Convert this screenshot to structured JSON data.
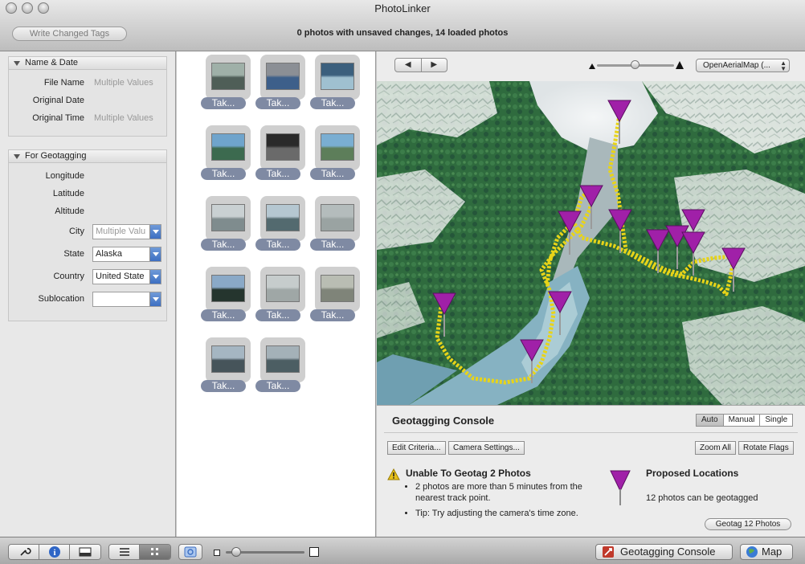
{
  "window": {
    "title": "PhotoLinker"
  },
  "toolbar": {
    "write_changed_tags": "Write Changed Tags",
    "status": "0 photos with unsaved changes, 14 loaded photos"
  },
  "inspector": {
    "name_date": {
      "title": "Name & Date",
      "fields": [
        {
          "label": "File Name",
          "value": "Multiple Values"
        },
        {
          "label": "Original Date",
          "value": ""
        },
        {
          "label": "Original Time",
          "value": "Multiple Values"
        }
      ]
    },
    "geotag": {
      "title": "For Geotagging",
      "longitude": "Longitude",
      "latitude": "Latitude",
      "altitude": "Altitude",
      "city_label": "City",
      "city_value": "Multiple Valu",
      "state_label": "State",
      "state_value": "Alaska",
      "country_label": "Country",
      "country_value": "United State",
      "sublocation_label": "Sublocation",
      "sublocation_value": ""
    }
  },
  "photos": {
    "caption": "Tak...",
    "items": [
      {
        "id": 1,
        "c1": "#9fb0a8",
        "c2": "#4f5e57"
      },
      {
        "id": 2,
        "c1": "#8b8f95",
        "c2": "#3d5f8a"
      },
      {
        "id": 3,
        "c1": "#3b5f7d",
        "c2": "#9fc0d0"
      },
      {
        "id": 4,
        "c1": "#6fa4cc",
        "c2": "#3c6a4f"
      },
      {
        "id": 5,
        "c1": "#2a2a2a",
        "c2": "#6a6a6a"
      },
      {
        "id": 6,
        "c1": "#7aaed2",
        "c2": "#5d7e5a"
      },
      {
        "id": 7,
        "c1": "#c9d0d2",
        "c2": "#7f8c8e"
      },
      {
        "id": 8,
        "c1": "#b5c7d1",
        "c2": "#536a6f"
      },
      {
        "id": 9,
        "c1": "#b4bcbc",
        "c2": "#9aa3a2"
      },
      {
        "id": 10,
        "c1": "#8aa9c7",
        "c2": "#25352e"
      },
      {
        "id": 11,
        "c1": "#c6cccc",
        "c2": "#9fa7a6"
      },
      {
        "id": 12,
        "c1": "#b9bdb3",
        "c2": "#7f8479"
      },
      {
        "id": 13,
        "c1": "#a5b6c2",
        "c2": "#46545a"
      },
      {
        "id": 14,
        "c1": "#a4b1b8",
        "c2": "#4c5e63"
      }
    ]
  },
  "map": {
    "nav_back": "◀",
    "nav_forward": "▶",
    "source": "OpenAerialMap (..."
  },
  "console": {
    "title": "Geotagging Console",
    "modes": [
      "Auto",
      "Manual",
      "Single"
    ],
    "active_mode": "Auto",
    "edit_criteria": "Edit Criteria...",
    "camera_settings": "Camera Settings...",
    "zoom_all": "Zoom All",
    "rotate_flags": "Rotate Flags",
    "warning_title": "Unable To Geotag 2 Photos",
    "warning_items": [
      "2 photos are more than 5 minutes from the nearest track point.",
      "Tip: Try adjusting the camera's time zone."
    ],
    "proposed_title": "Proposed Locations",
    "proposed_sub": "12 photos can be geotagged",
    "geotag_button": "Geotag 12 Photos"
  },
  "bottombar": {
    "geotagging_console": "Geotagging Console",
    "map": "Map"
  },
  "colors": {
    "flag": "#a020a8",
    "track": "#e8d418",
    "caption_bg": "#7f8aa3"
  }
}
